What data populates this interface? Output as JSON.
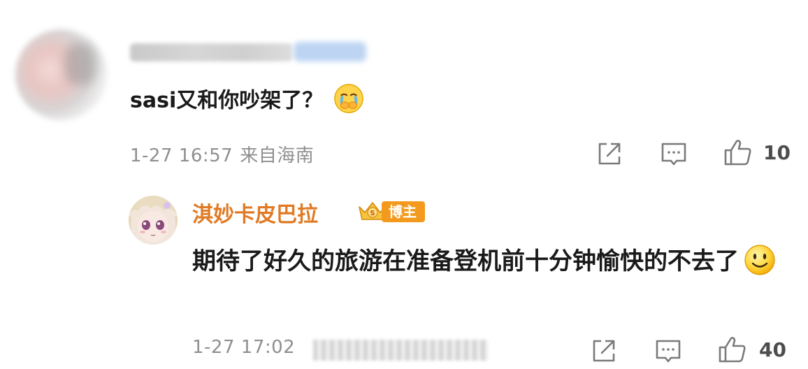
{
  "comment": {
    "text": "sasi又和你吵架了？",
    "emoji": "crying-face-emoji",
    "date": "1-27 16:57",
    "location": "来自海南",
    "likes": "10"
  },
  "reply": {
    "username": "淇妙卡皮巴拉",
    "badge": "博主",
    "text": "期待了好久的旅游在准备登机前十分钟愉快的不去了",
    "emoji": "smiling-face-emoji",
    "date": "1-27 17:02",
    "likes": "40"
  },
  "icons": {
    "share": "share-icon",
    "comment": "comment-icon",
    "like": "thumbs-up-icon"
  },
  "colors": {
    "username_orange": "#e07a24",
    "badge_orange": "#f39a1e",
    "meta_gray": "#8f8f8f",
    "text_dark": "#1a1a1a"
  }
}
